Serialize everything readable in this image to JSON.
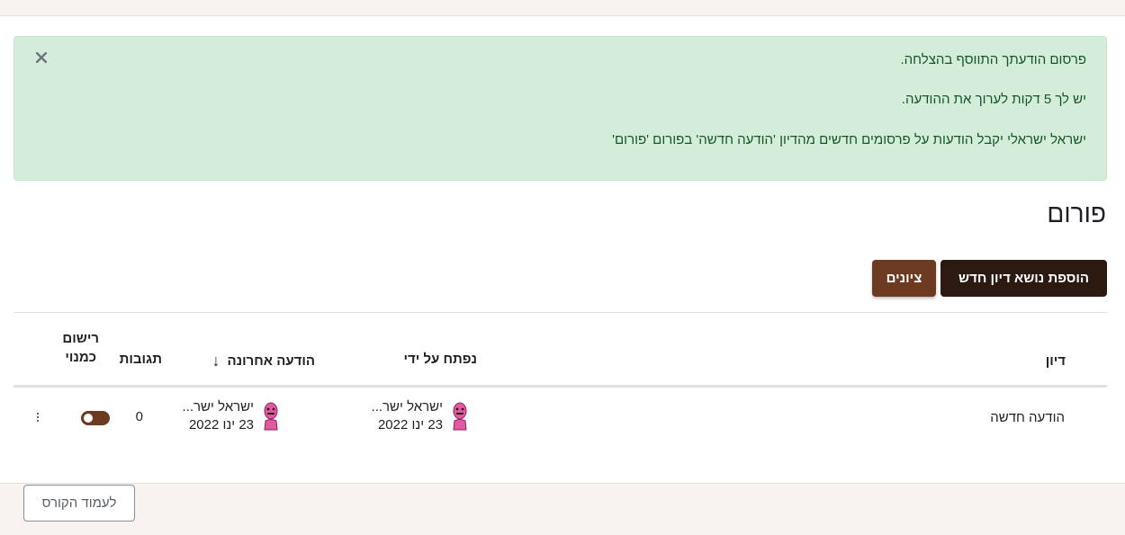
{
  "alert": {
    "lines": [
      "פרסום הודעתך התווסף בהצלחה.",
      "יש לך 5 דקות לערוך את ההודעה.",
      "ישראל ישראלי יקבל הודעות על פרסומים חדשים מהדיון 'הודעה חדשה' בפורום 'פורום'"
    ],
    "close_icon": "close-icon",
    "colors": {
      "background": "#d4edda",
      "text": "#155724"
    }
  },
  "page": {
    "title": "פורום"
  },
  "toolbar": {
    "add_topic_label": "הוספת נושא דיון חדש",
    "grades_label": "ציונים"
  },
  "table": {
    "headers": {
      "topic": "דיון",
      "started_by": "נפתח על ידי",
      "last_post": "הודעה אחרונה",
      "last_post_sort_icon": "arrow-down-icon",
      "replies": "תגובות",
      "subscription_line1": "רישום",
      "subscription_line2": "כמנוי"
    },
    "rows": [
      {
        "topic": "הודעה חדשה",
        "started_by_name": "ישראל ישר...",
        "started_by_date": "23 ינו 2022",
        "last_post_name": "ישראל ישר...",
        "last_post_date": "23 ינו 2022",
        "replies": "0",
        "subscribed": true
      }
    ]
  },
  "footer": {
    "back_label": "לעמוד הקורס"
  },
  "colors": {
    "primary_dark": "#2c1a10",
    "primary": "#6b3a20"
  }
}
